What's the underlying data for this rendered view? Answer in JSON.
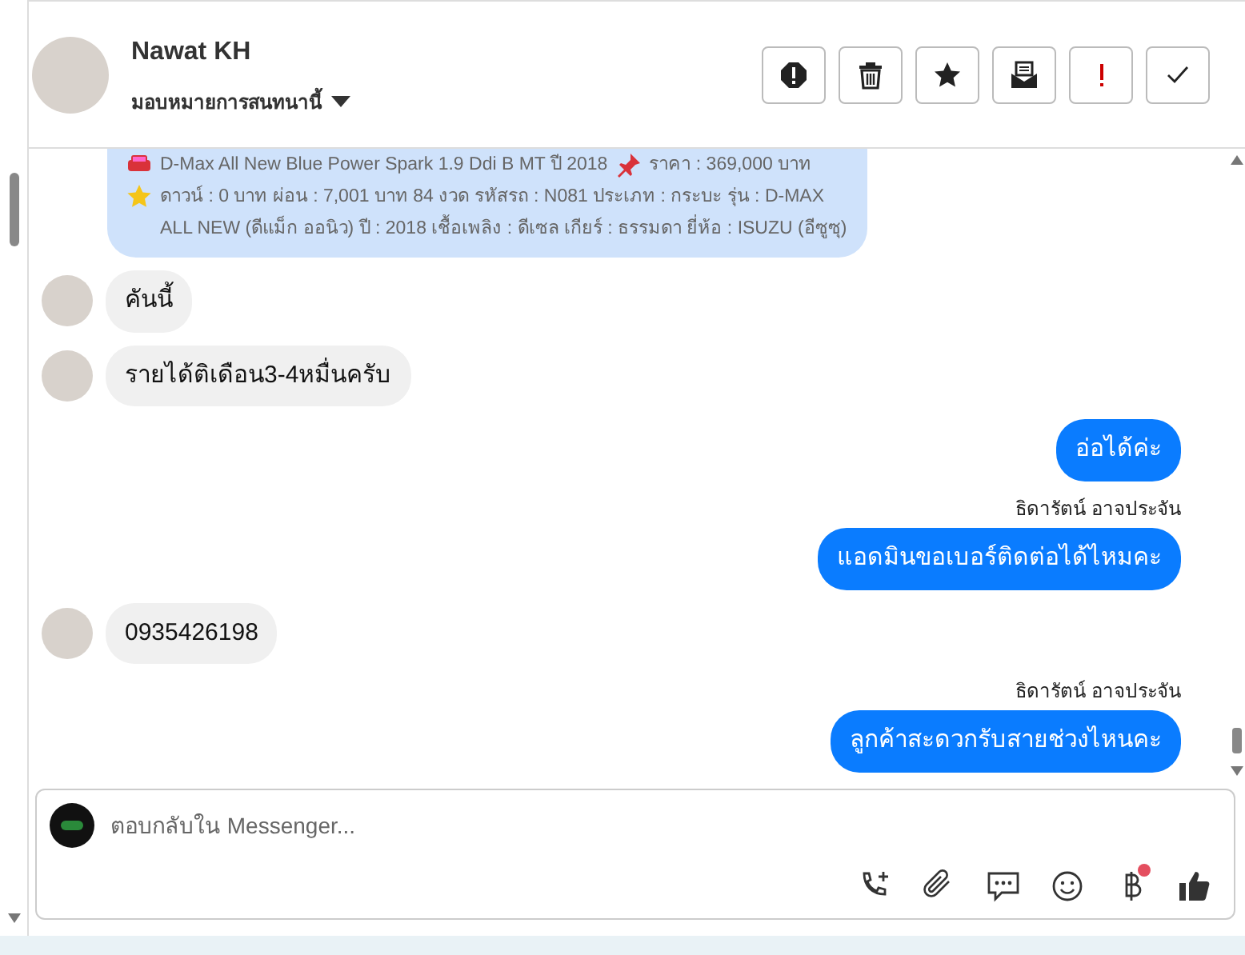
{
  "header": {
    "name": "Nawat KH",
    "assign_label": "มอบหมายการสนทนานี้",
    "actions": [
      {
        "kind": "report"
      },
      {
        "kind": "delete"
      },
      {
        "kind": "star"
      },
      {
        "kind": "mail"
      },
      {
        "kind": "important"
      },
      {
        "kind": "done"
      }
    ]
  },
  "messages": [
    {
      "kind": "card",
      "lines": [
        {
          "text": "D-Max All New Blue Power Spark 1.9 Ddi B MT ปี 2018"
        },
        {
          "text": "ราคา : 369,000 บาท"
        },
        {
          "text": "ดาวน์ : 0 บาท ผ่อน : 7,001 บาท 84 งวด รหัสรถ : N081 ประเภท : กระบะ รุ่น : D-MAX ALL NEW (ดีแม็ก ออนิว) ปี : 2018 เชื้อเพลิง : ดีเซล เกียร์ : ธรรมดา ยี่ห้อ : ISUZU (อีซูซุ)"
        }
      ]
    },
    {
      "kind": "incoming",
      "text": "คันนี้"
    },
    {
      "kind": "incoming",
      "text": "รายได้ติเดือน3-4หมื่นครับ"
    },
    {
      "kind": "outgoing",
      "text": "อ่อได้ค่ะ"
    },
    {
      "kind": "outgoing",
      "sender": "ธิดารัตน์ อาจประจัน",
      "text": "แอดมินขอเบอร์ติดต่อได้ไหมคะ"
    },
    {
      "kind": "incoming",
      "text": "0935426198"
    },
    {
      "kind": "outgoing",
      "sender": "ธิดารัตน์ อาจประจัน",
      "text": "ลูกค้าสะดวกรับสายช่วงไหนคะ"
    }
  ],
  "composer": {
    "placeholder": "ตอบกลับใน Messenger...",
    "tools": [
      {
        "kind": "call"
      },
      {
        "kind": "attach"
      },
      {
        "kind": "chat"
      },
      {
        "kind": "emoji"
      },
      {
        "kind": "baht"
      },
      {
        "kind": "like"
      }
    ]
  }
}
